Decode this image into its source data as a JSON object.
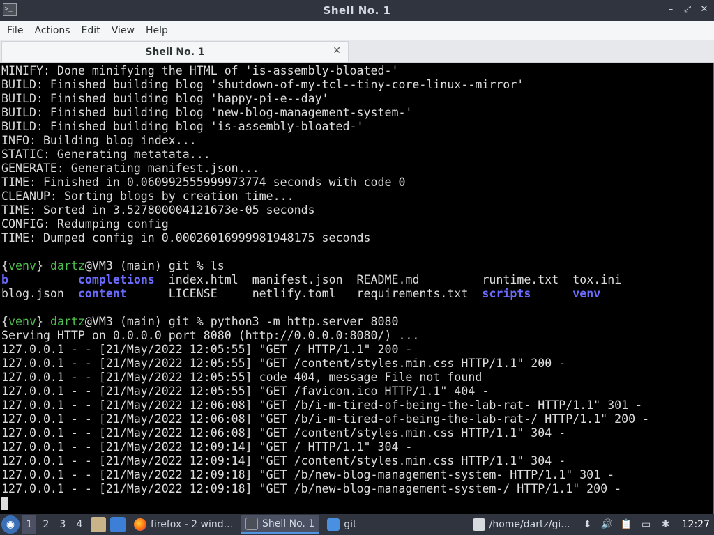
{
  "window": {
    "title": "Shell No. 1",
    "app_icon_text": ">_",
    "controls": {
      "minimize": "–",
      "maximize": "⤢",
      "close": "✕"
    }
  },
  "menubar": [
    "File",
    "Actions",
    "Edit",
    "View",
    "Help"
  ],
  "tab": {
    "label": "Shell No. 1",
    "close": "✕"
  },
  "terminal": {
    "lines": [
      "MINIFY: Done minifying the HTML of 'is-assembly-bloated-'",
      "BUILD: Finished building blog 'shutdown-of-my-tcl--tiny-core-linux--mirror'",
      "BUILD: Finished building blog 'happy-pi-e--day'",
      "BUILD: Finished building blog 'new-blog-management-system-'",
      "BUILD: Finished building blog 'is-assembly-bloated-'",
      "INFO: Building blog index...",
      "STATIC: Generating metatata...",
      "GENERATE: Generating manifest.json...",
      "TIME: Finished in 0.060992555999973774 seconds with code 0",
      "CLEANUP: Sorting blogs by creation time...",
      "TIME: Sorted in 3.527800004121673e-05 seconds",
      "CONFIG: Redumping config",
      "TIME: Dumped config in 0.00026016999981948175 seconds",
      ""
    ],
    "prompt1": {
      "venv": "venv",
      "user": "dartz",
      "rest": "@VM3 (main) git % ls"
    },
    "ls_rows": [
      [
        {
          "text": "b",
          "dir": true
        },
        {
          "text": "completions",
          "dir": true
        },
        {
          "text": "index.html",
          "dir": false
        },
        {
          "text": "manifest.json",
          "dir": false
        },
        {
          "text": "README.md",
          "dir": false
        },
        {
          "text": "runtime.txt",
          "dir": false
        },
        {
          "text": "tox.ini",
          "dir": false
        }
      ],
      [
        {
          "text": "blog.json",
          "dir": false
        },
        {
          "text": "content",
          "dir": true
        },
        {
          "text": "LICENSE",
          "dir": false
        },
        {
          "text": "netlify.toml",
          "dir": false
        },
        {
          "text": "requirements.txt",
          "dir": false
        },
        {
          "text": "scripts",
          "dir": true
        },
        {
          "text": "venv",
          "dir": true
        }
      ]
    ],
    "prompt2": {
      "venv": "venv",
      "user": "dartz",
      "rest": "@VM3 (main) git % python3 -m http.server 8080"
    },
    "server_lines": [
      "Serving HTTP on 0.0.0.0 port 8080 (http://0.0.0.0:8080/) ...",
      "127.0.0.1 - - [21/May/2022 12:05:55] \"GET / HTTP/1.1\" 200 -",
      "127.0.0.1 - - [21/May/2022 12:05:55] \"GET /content/styles.min.css HTTP/1.1\" 200 -",
      "127.0.0.1 - - [21/May/2022 12:05:55] code 404, message File not found",
      "127.0.0.1 - - [21/May/2022 12:05:55] \"GET /favicon.ico HTTP/1.1\" 404 -",
      "127.0.0.1 - - [21/May/2022 12:06:08] \"GET /b/i-m-tired-of-being-the-lab-rat- HTTP/1.1\" 301 -",
      "127.0.0.1 - - [21/May/2022 12:06:08] \"GET /b/i-m-tired-of-being-the-lab-rat-/ HTTP/1.1\" 200 -",
      "127.0.0.1 - - [21/May/2022 12:06:08] \"GET /content/styles.min.css HTTP/1.1\" 304 -",
      "127.0.0.1 - - [21/May/2022 12:09:14] \"GET / HTTP/1.1\" 304 -",
      "127.0.0.1 - - [21/May/2022 12:09:14] \"GET /content/styles.min.css HTTP/1.1\" 304 -",
      "127.0.0.1 - - [21/May/2022 12:09:18] \"GET /b/new-blog-management-system- HTTP/1.1\" 301 -",
      "127.0.0.1 - - [21/May/2022 12:09:18] \"GET /b/new-blog-management-system-/ HTTP/1.1\" 200 -"
    ]
  },
  "taskbar": {
    "workspaces": [
      "1",
      "2",
      "3",
      "4"
    ],
    "tasks": [
      {
        "label": "firefox - 2 wind...",
        "icon": "firefox-icon",
        "active": false
      },
      {
        "label": "Shell No. 1",
        "icon": "terminal-icon",
        "active": true
      },
      {
        "label": "git",
        "icon": "folder-icon",
        "active": false
      },
      {
        "label": "/home/dartz/gi...",
        "icon": "text-editor-icon",
        "active": false
      }
    ],
    "clock": "12:27"
  },
  "colors": {
    "titlebar": "#2f343f",
    "terminal_bg": "#000000",
    "prompt_green": "#4fbf4f",
    "dir_blue": "#6b6bff",
    "accent": "#5294e2"
  }
}
